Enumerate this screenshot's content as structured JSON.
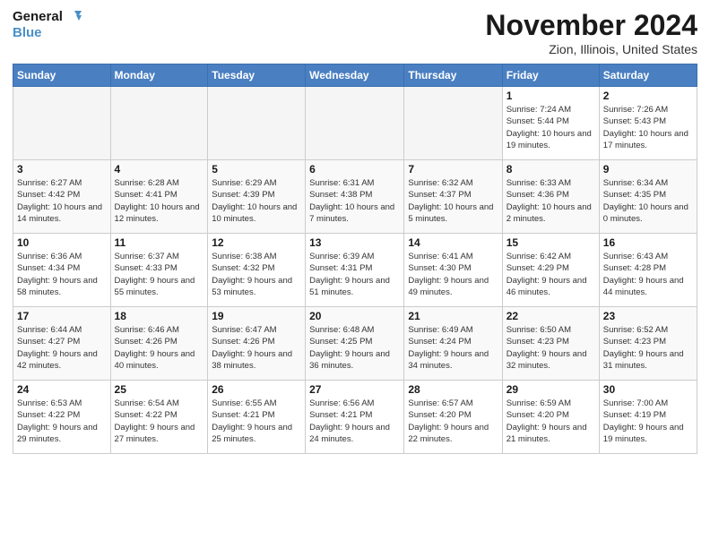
{
  "logo": {
    "text_general": "General",
    "text_blue": "Blue"
  },
  "header": {
    "month_year": "November 2024",
    "location": "Zion, Illinois, United States"
  },
  "weekdays": [
    "Sunday",
    "Monday",
    "Tuesday",
    "Wednesday",
    "Thursday",
    "Friday",
    "Saturday"
  ],
  "weeks": [
    [
      {
        "day": "",
        "info": ""
      },
      {
        "day": "",
        "info": ""
      },
      {
        "day": "",
        "info": ""
      },
      {
        "day": "",
        "info": ""
      },
      {
        "day": "",
        "info": ""
      },
      {
        "day": "1",
        "info": "Sunrise: 7:24 AM\nSunset: 5:44 PM\nDaylight: 10 hours and 19 minutes."
      },
      {
        "day": "2",
        "info": "Sunrise: 7:26 AM\nSunset: 5:43 PM\nDaylight: 10 hours and 17 minutes."
      }
    ],
    [
      {
        "day": "3",
        "info": "Sunrise: 6:27 AM\nSunset: 4:42 PM\nDaylight: 10 hours and 14 minutes."
      },
      {
        "day": "4",
        "info": "Sunrise: 6:28 AM\nSunset: 4:41 PM\nDaylight: 10 hours and 12 minutes."
      },
      {
        "day": "5",
        "info": "Sunrise: 6:29 AM\nSunset: 4:39 PM\nDaylight: 10 hours and 10 minutes."
      },
      {
        "day": "6",
        "info": "Sunrise: 6:31 AM\nSunset: 4:38 PM\nDaylight: 10 hours and 7 minutes."
      },
      {
        "day": "7",
        "info": "Sunrise: 6:32 AM\nSunset: 4:37 PM\nDaylight: 10 hours and 5 minutes."
      },
      {
        "day": "8",
        "info": "Sunrise: 6:33 AM\nSunset: 4:36 PM\nDaylight: 10 hours and 2 minutes."
      },
      {
        "day": "9",
        "info": "Sunrise: 6:34 AM\nSunset: 4:35 PM\nDaylight: 10 hours and 0 minutes."
      }
    ],
    [
      {
        "day": "10",
        "info": "Sunrise: 6:36 AM\nSunset: 4:34 PM\nDaylight: 9 hours and 58 minutes."
      },
      {
        "day": "11",
        "info": "Sunrise: 6:37 AM\nSunset: 4:33 PM\nDaylight: 9 hours and 55 minutes."
      },
      {
        "day": "12",
        "info": "Sunrise: 6:38 AM\nSunset: 4:32 PM\nDaylight: 9 hours and 53 minutes."
      },
      {
        "day": "13",
        "info": "Sunrise: 6:39 AM\nSunset: 4:31 PM\nDaylight: 9 hours and 51 minutes."
      },
      {
        "day": "14",
        "info": "Sunrise: 6:41 AM\nSunset: 4:30 PM\nDaylight: 9 hours and 49 minutes."
      },
      {
        "day": "15",
        "info": "Sunrise: 6:42 AM\nSunset: 4:29 PM\nDaylight: 9 hours and 46 minutes."
      },
      {
        "day": "16",
        "info": "Sunrise: 6:43 AM\nSunset: 4:28 PM\nDaylight: 9 hours and 44 minutes."
      }
    ],
    [
      {
        "day": "17",
        "info": "Sunrise: 6:44 AM\nSunset: 4:27 PM\nDaylight: 9 hours and 42 minutes."
      },
      {
        "day": "18",
        "info": "Sunrise: 6:46 AM\nSunset: 4:26 PM\nDaylight: 9 hours and 40 minutes."
      },
      {
        "day": "19",
        "info": "Sunrise: 6:47 AM\nSunset: 4:26 PM\nDaylight: 9 hours and 38 minutes."
      },
      {
        "day": "20",
        "info": "Sunrise: 6:48 AM\nSunset: 4:25 PM\nDaylight: 9 hours and 36 minutes."
      },
      {
        "day": "21",
        "info": "Sunrise: 6:49 AM\nSunset: 4:24 PM\nDaylight: 9 hours and 34 minutes."
      },
      {
        "day": "22",
        "info": "Sunrise: 6:50 AM\nSunset: 4:23 PM\nDaylight: 9 hours and 32 minutes."
      },
      {
        "day": "23",
        "info": "Sunrise: 6:52 AM\nSunset: 4:23 PM\nDaylight: 9 hours and 31 minutes."
      }
    ],
    [
      {
        "day": "24",
        "info": "Sunrise: 6:53 AM\nSunset: 4:22 PM\nDaylight: 9 hours and 29 minutes."
      },
      {
        "day": "25",
        "info": "Sunrise: 6:54 AM\nSunset: 4:22 PM\nDaylight: 9 hours and 27 minutes."
      },
      {
        "day": "26",
        "info": "Sunrise: 6:55 AM\nSunset: 4:21 PM\nDaylight: 9 hours and 25 minutes."
      },
      {
        "day": "27",
        "info": "Sunrise: 6:56 AM\nSunset: 4:21 PM\nDaylight: 9 hours and 24 minutes."
      },
      {
        "day": "28",
        "info": "Sunrise: 6:57 AM\nSunset: 4:20 PM\nDaylight: 9 hours and 22 minutes."
      },
      {
        "day": "29",
        "info": "Sunrise: 6:59 AM\nSunset: 4:20 PM\nDaylight: 9 hours and 21 minutes."
      },
      {
        "day": "30",
        "info": "Sunrise: 7:00 AM\nSunset: 4:19 PM\nDaylight: 9 hours and 19 minutes."
      }
    ]
  ]
}
